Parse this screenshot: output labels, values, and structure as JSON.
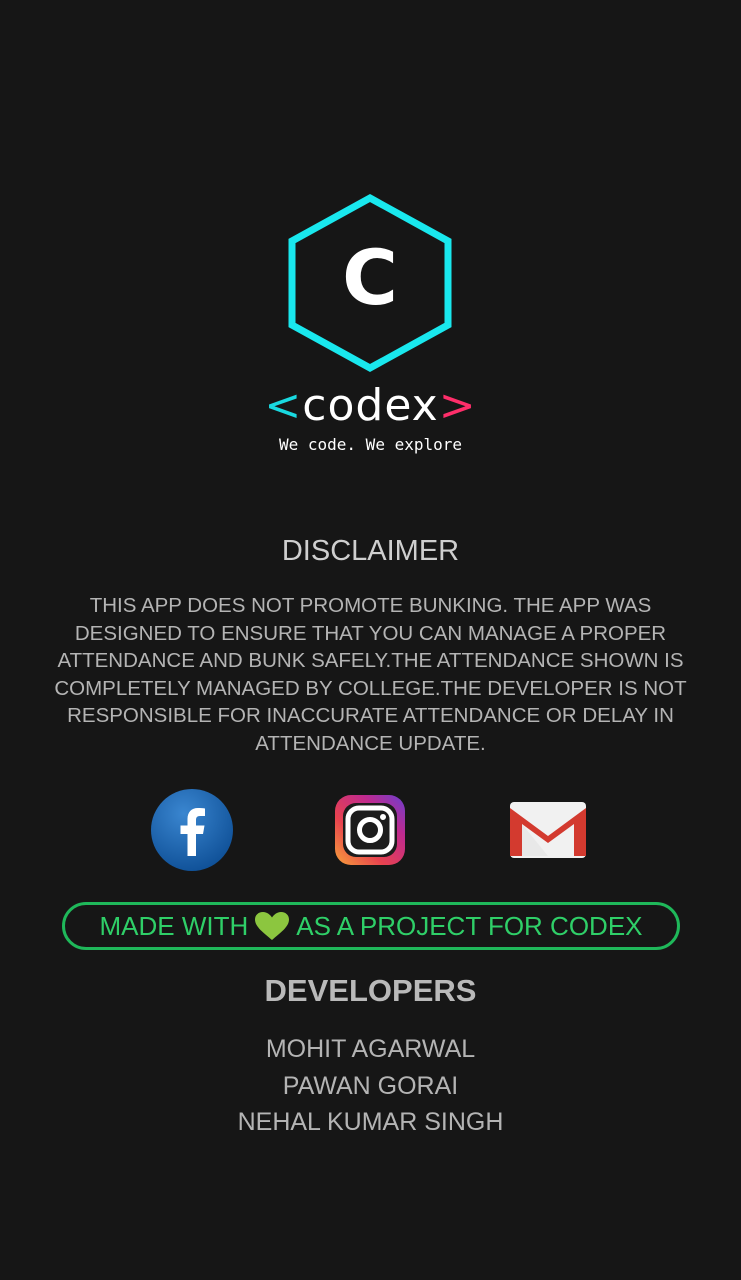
{
  "logo": {
    "icon_letter": "C",
    "brand_open": "<",
    "brand_name": "codex",
    "brand_close": ">",
    "tagline": "We code. We explore",
    "colors": {
      "hexagon": "#19e8ee",
      "bracket_left": "#19d9e0",
      "bracket_right": "#ff2e6a"
    }
  },
  "disclaimer": {
    "title": "DISCLAIMER",
    "text": "THIS APP DOES NOT PROMOTE BUNKING. THE APP WAS DESIGNED TO ENSURE THAT YOU CAN MANAGE A PROPER ATTENDANCE AND BUNK SAFELY.THE ATTENDANCE SHOWN IS COMPLETELY MANAGED BY COLLEGE.THE DEVELOPER IS NOT RESPONSIBLE FOR INACCURATE ATTENDANCE OR DELAY IN ATTENDANCE UPDATE."
  },
  "social": [
    {
      "icon": "facebook-icon"
    },
    {
      "icon": "instagram-icon"
    },
    {
      "icon": "gmail-icon"
    }
  ],
  "made_with": {
    "prefix": "MADE WITH",
    "icon": "heart-icon",
    "suffix": "AS A PROJECT FOR CODEX",
    "colors": {
      "border": "#1fb85a",
      "text": "#2fcf68",
      "heart": "#8cc63f"
    }
  },
  "developers": {
    "title": "DEVELOPERS",
    "names": [
      "MOHIT AGARWAL",
      "PAWAN GORAI",
      "NEHAL KUMAR SINGH"
    ]
  }
}
